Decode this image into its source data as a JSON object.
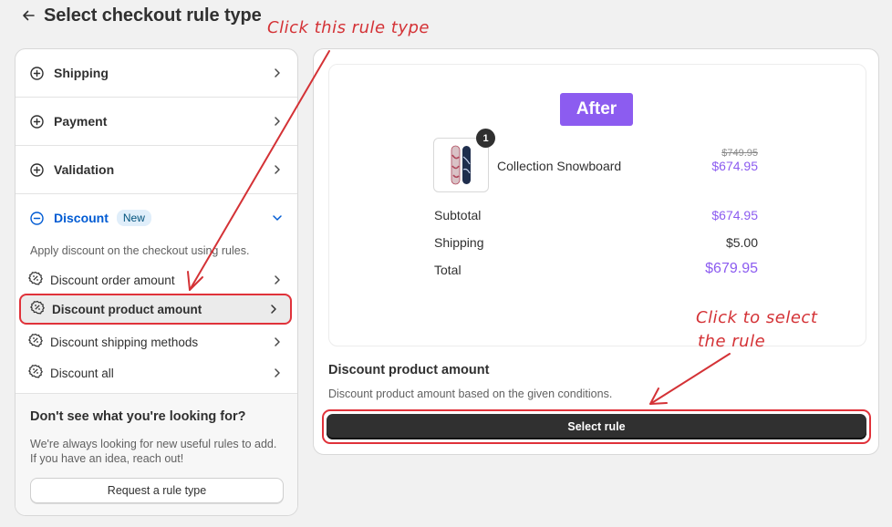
{
  "header": {
    "title": "Select checkout rule type"
  },
  "categories": [
    {
      "label": "Shipping"
    },
    {
      "label": "Payment"
    },
    {
      "label": "Validation"
    }
  ],
  "discount": {
    "label": "Discount",
    "badge": "New",
    "description": "Apply discount on the checkout using rules.",
    "rules": [
      {
        "label": "Discount order amount"
      },
      {
        "label": "Discount product amount",
        "selected": true
      },
      {
        "label": "Discount shipping methods"
      },
      {
        "label": "Discount all"
      }
    ]
  },
  "footer": {
    "title": "Don't see what you're looking for?",
    "text": "We're always looking for new useful rules to add. If you have an idea, reach out!",
    "button": "Request a rule type"
  },
  "preview": {
    "badge": "After",
    "quantity": "1",
    "product_name": "Collection Snowboard",
    "old_price": "$749.95",
    "new_price": "$674.95",
    "subtotal_label": "Subtotal",
    "subtotal_value": "$674.95",
    "shipping_label": "Shipping",
    "shipping_value": "$5.00",
    "total_label": "Total",
    "total_value": "$679.95"
  },
  "selected_rule": {
    "title": "Discount product amount",
    "description": "Discount product amount based on the given conditions.",
    "button": "Select rule"
  },
  "annotations": {
    "left": "Click this rule type",
    "right_line1": "Click to select",
    "right_line2": "the rule"
  },
  "colors": {
    "accent_purple": "#8c5cf0",
    "annotation_red": "#d43236",
    "discount_blue": "#005bd3"
  }
}
